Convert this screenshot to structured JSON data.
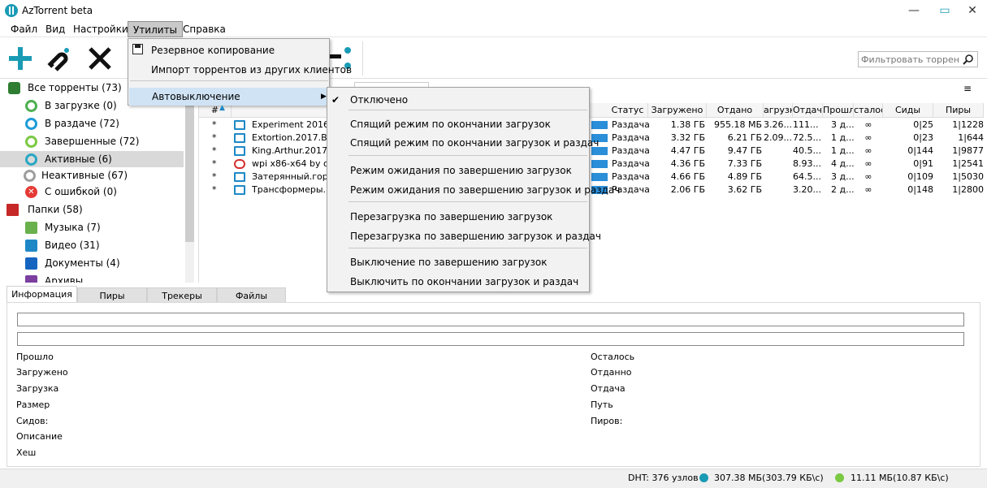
{
  "window": {
    "title": "AzTorrent beta"
  },
  "menu": [
    "Файл",
    "Вид",
    "Настройки",
    "Утилиты",
    "Справка"
  ],
  "utilities_menu": {
    "items": [
      "Резервное копирование",
      "Импорт торрентов из других клиентов"
    ],
    "submenu_parent": "Автовыключение"
  },
  "autoshutdown_menu": {
    "checked": "Отключено",
    "groups": [
      [
        "Спящий режим по окончании загрузок",
        "Спящий режим  по окончании загрузок и раздач"
      ],
      [
        "Режим ожидания по завершению загрузок",
        "Режим ожидания по завершению загрузок и раздач"
      ],
      [
        "Перезагрузка по завершению загрузок",
        "Перезагрузка по завершению загрузок и раздач"
      ],
      [
        "Выключение по завершению загрузок",
        "Выключить по окончании загрузок и раздач"
      ]
    ]
  },
  "toolbar": {
    "filter_placeholder": "Фильтровать торренты"
  },
  "sidebar": {
    "all": "Все торренты (73)",
    "states": [
      {
        "label": "В загрузке (0)",
        "icon": "download-state-icon",
        "color": "#4caf50"
      },
      {
        "label": "В раздаче (72)",
        "icon": "seeding-state-icon",
        "color": "#1e9bd7"
      },
      {
        "label": "Завершенные (72)",
        "icon": "completed-state-icon",
        "color": "#7ac943"
      },
      {
        "label": "Активные (6)",
        "icon": "active-state-icon",
        "color": "#29a7c4"
      },
      {
        "label": "Неактивные (67)",
        "icon": "inactive-state-icon",
        "color": "#9e9e9e"
      },
      {
        "label": "С ошибкой (0)",
        "icon": "error-state-icon",
        "color": "#e53935"
      }
    ],
    "folders": "Папки (58)",
    "folder_items": [
      {
        "label": "Музыка (7)",
        "icon": "music-folder-icon",
        "color": "#6ab04c"
      },
      {
        "label": "Видео (31)",
        "icon": "video-folder-icon",
        "color": "#1e88c7"
      },
      {
        "label": "Документы (4)",
        "icon": "documents-folder-icon",
        "color": "#1565c0"
      },
      {
        "label": "Архивы",
        "icon": "archive-folder-icon",
        "color": "#7b3fa0"
      }
    ]
  },
  "columns": [
    "#",
    "Статус",
    "Загружено",
    "Отдано",
    "агрузка",
    "Отдача",
    "Прошло",
    "сталось",
    "Сиды",
    "Пиры"
  ],
  "torrents": [
    {
      "n": "*",
      "name": "Experiment 2016 H",
      "icon": "film",
      "status": "Раздача",
      "down": "1.38 ГБ",
      "up": "955.18 МБ",
      "dl": "3.26...",
      "ul": "111...",
      "elapsed": "3 д...",
      "left": "∞",
      "seeds": "0|25",
      "peers": "1|1228"
    },
    {
      "n": "*",
      "name": "Extortion.2017.BD",
      "icon": "film",
      "status": "Раздача",
      "down": "3.32 ГБ",
      "up": "6.21 ГБ",
      "dl": "2.09...",
      "ul": "72.5...",
      "elapsed": "1 д...",
      "left": "∞",
      "seeds": "0|23",
      "peers": "1|644"
    },
    {
      "n": "*",
      "name": "King.Arthur.2017.",
      "icon": "film",
      "status": "Раздача",
      "down": "4.47 ГБ",
      "up": "9.47 ГБ",
      "dl": "",
      "ul": "40.5...",
      "elapsed": "1 д...",
      "left": "∞",
      "seeds": "0|144",
      "peers": "1|9877"
    },
    {
      "n": "*",
      "name": "wpi x86-x64 by ov",
      "icon": "app",
      "status": "Раздача",
      "down": "4.36 ГБ",
      "up": "7.33 ГБ",
      "dl": "",
      "ul": "8.93...",
      "elapsed": "4 д...",
      "left": "∞",
      "seeds": "0|91",
      "peers": "1|2541"
    },
    {
      "n": "*",
      "name": "Затерянный.горо",
      "icon": "film",
      "status": "Раздача",
      "down": "4.66 ГБ",
      "up": "4.89 ГБ",
      "dl": "",
      "ul": "64.5...",
      "elapsed": "3 д...",
      "left": "∞",
      "seeds": "0|109",
      "peers": "1|5030"
    },
    {
      "n": "*",
      "name": "Трансформеры.l",
      "icon": "film",
      "status": "Раздача",
      "down": "2.06 ГБ",
      "up": "3.62 ГБ",
      "dl": "",
      "ul": "3.20...",
      "elapsed": "2 д...",
      "left": "∞",
      "seeds": "0|148",
      "peers": "1|2800"
    }
  ],
  "tabs": [
    "Информация",
    "Пиры",
    "Трекеры",
    "Файлы"
  ],
  "info": {
    "left": [
      "Прошло",
      "Загружено",
      "Загрузка",
      "Размер",
      "Сидов:",
      "Описание",
      "Хеш"
    ],
    "right": [
      "Осталось",
      "Отданно",
      "Отдача",
      "Путь",
      "Пиров:"
    ]
  },
  "status": {
    "dht": "DHT: 376 узлов",
    "down": "307.38 МБ(303.79 КБ\\с)",
    "up": "11.11 МБ(10.87 КБ\\с)"
  }
}
